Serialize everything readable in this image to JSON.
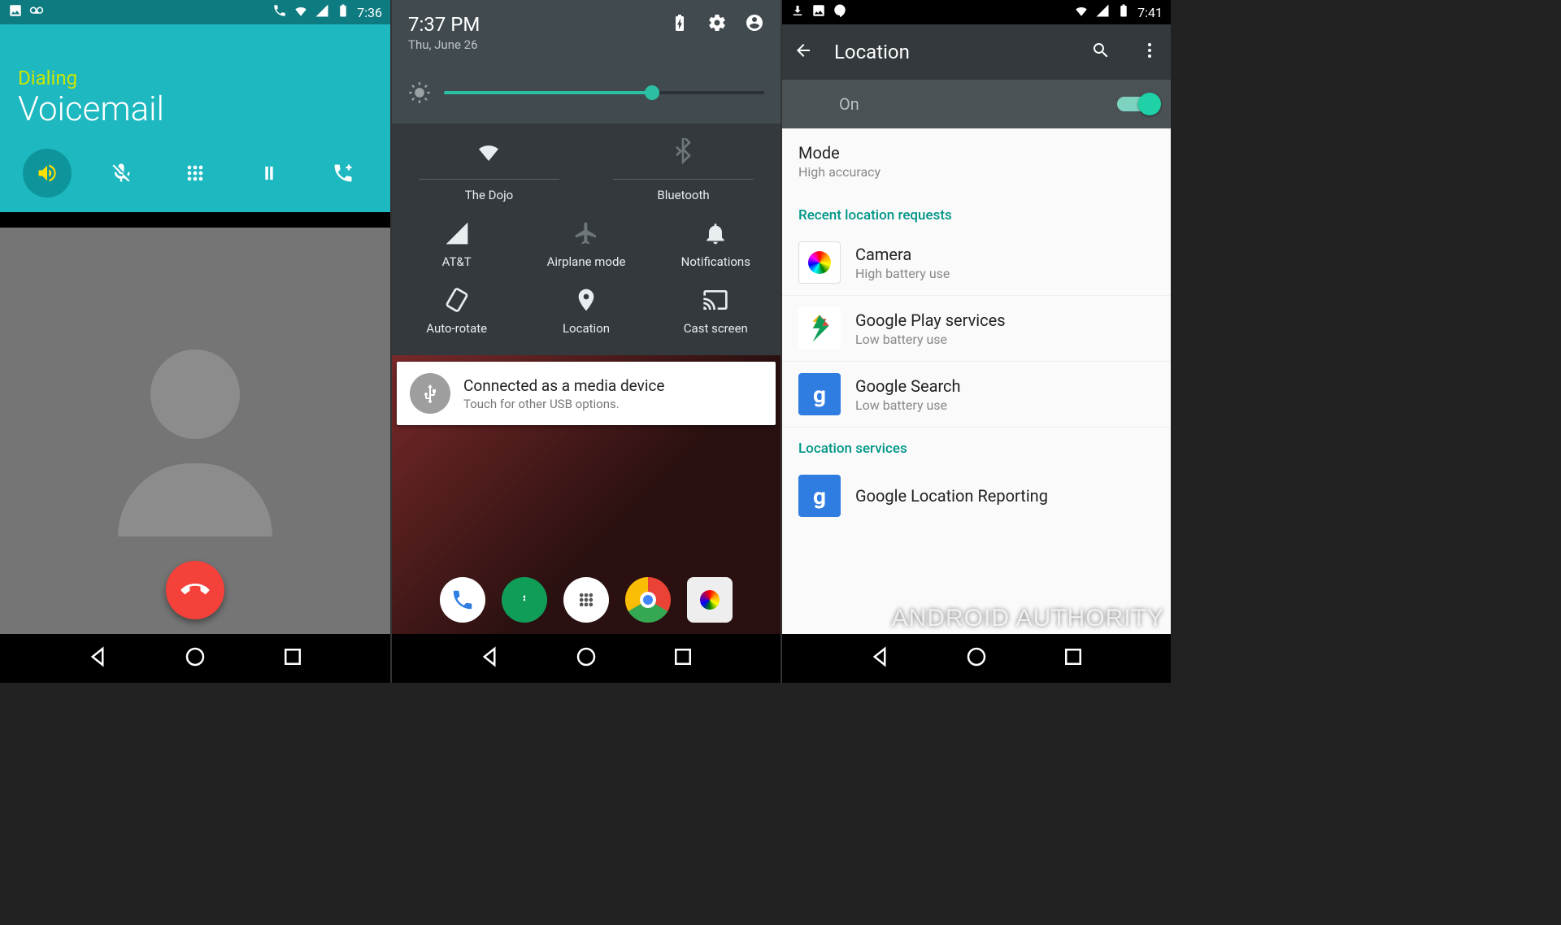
{
  "phone1": {
    "statusbar_time": "7:36",
    "dialer_status": "Dialing",
    "dialer_name": "Voicemail"
  },
  "phone2": {
    "qs_time": "7:37 PM",
    "qs_date": "Thu, June 26",
    "brightness_percent": 65,
    "tiles": {
      "wifi": "The Dojo",
      "bluetooth": "Bluetooth",
      "cell": "AT&T",
      "airplane": "Airplane mode",
      "notifications": "Notifications",
      "rotate": "Auto-rotate",
      "location": "Location",
      "cast": "Cast screen"
    },
    "notification": {
      "title": "Connected as a media device",
      "subtitle": "Touch for other USB options."
    }
  },
  "phone3": {
    "statusbar_time": "7:41",
    "appbar_title": "Location",
    "toggle_state": "On",
    "mode": {
      "title": "Mode",
      "value": "High accuracy"
    },
    "section_recent": "Recent location requests",
    "recent": [
      {
        "name": "Camera",
        "detail": "High battery use"
      },
      {
        "name": "Google Play services",
        "detail": "Low battery use"
      },
      {
        "name": "Google Search",
        "detail": "Low battery use"
      }
    ],
    "section_services": "Location services",
    "services": [
      {
        "name": "Google Location Reporting"
      }
    ]
  },
  "watermark": "ANDROID AUTHORITY"
}
